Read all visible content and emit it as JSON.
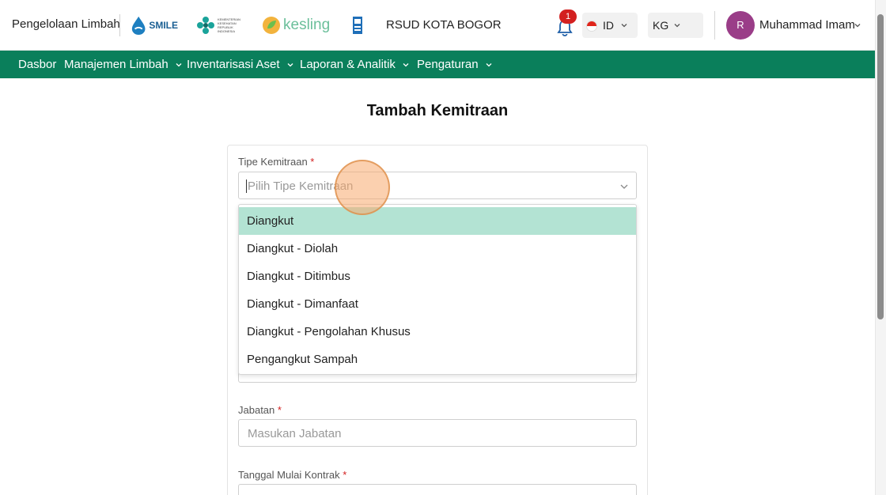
{
  "header": {
    "app_title": "Pengelolaan Limbah",
    "logos": {
      "smile": "SMILE",
      "kemenkes": "KEMENTERIAN KESEHATAN REPUBLIK INDONESIA",
      "kesling": "kesling"
    },
    "hospital_name": "RSUD KOTA BOGOR",
    "notification_count": "1",
    "language": "ID",
    "unit": "KG",
    "avatar_initial": "R",
    "user_name": "Muhammad Imam"
  },
  "nav": {
    "items": [
      {
        "label": "Dasbor",
        "has_dropdown": false
      },
      {
        "label": "Manajemen Limbah",
        "has_dropdown": true
      },
      {
        "label": "Inventarisasi Aset",
        "has_dropdown": true
      },
      {
        "label": "Laporan & Analitik",
        "has_dropdown": true
      },
      {
        "label": "Pengaturan",
        "has_dropdown": true
      }
    ]
  },
  "page": {
    "title": "Tambah Kemitraan"
  },
  "form": {
    "tipe_kemitraan": {
      "label": "Tipe Kemitraan",
      "required_mark": "*",
      "placeholder": "Pilih Tipe Kemitraan",
      "options": [
        "Diangkut",
        "Diangkut - Diolah",
        "Diangkut - Ditimbus",
        "Diangkut - Dimanfaat",
        "Diangkut - Pengolahan Khusus",
        "Pengangkut Sampah"
      ],
      "highlighted_index": 0
    },
    "jabatan": {
      "label": "Jabatan",
      "required_mark": "*",
      "placeholder": "Masukan Jabatan"
    },
    "tanggal_mulai": {
      "label": "Tanggal Mulai Kontrak",
      "required_mark": "*"
    }
  },
  "colors": {
    "nav_bg": "#0a7f5b",
    "option_highlight": "#b3e3d3",
    "badge": "#d32020",
    "avatar": "#9a3d88"
  }
}
